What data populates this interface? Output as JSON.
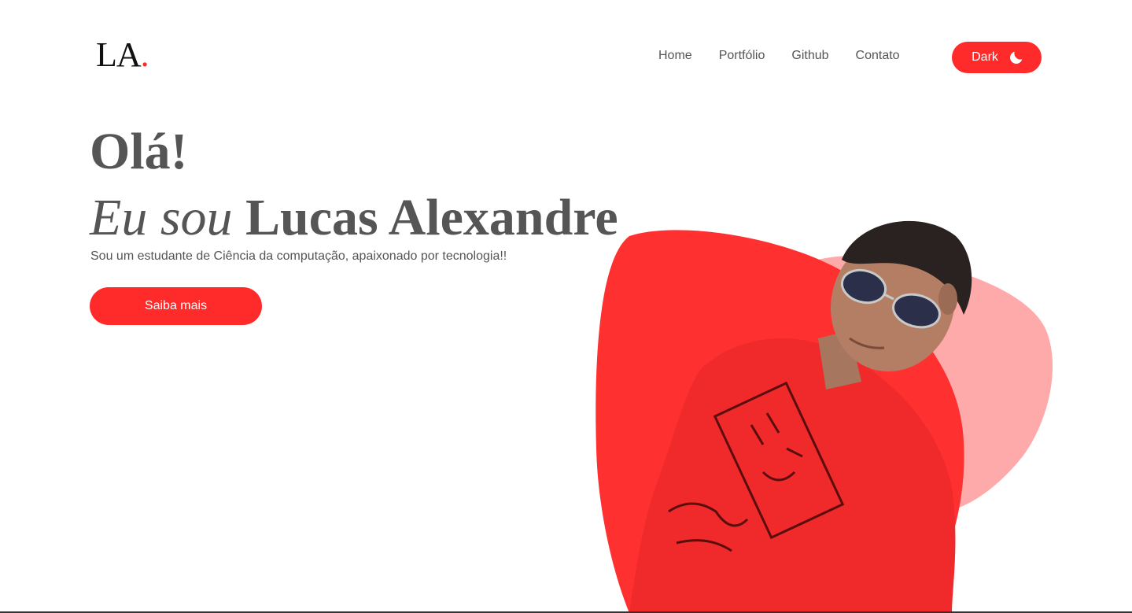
{
  "logo": {
    "text": "LA",
    "dot": "."
  },
  "nav": {
    "items": [
      {
        "label": "Home"
      },
      {
        "label": "Portfólio"
      },
      {
        "label": "Github"
      },
      {
        "label": "Contato"
      }
    ]
  },
  "theme_toggle": {
    "label": "Dark",
    "icon": "moon-icon"
  },
  "hero": {
    "greeting": "Olá!",
    "intro_prefix": "Eu sou",
    "name": "Lucas Alexandre",
    "subtitle": "Sou um estudante de Ciência da computação, apaixonado por tecnologia!!",
    "cta_label": "Saiba mais",
    "photo": "person-photo"
  },
  "colors": {
    "accent": "#ff2a2a",
    "accent_light": "#ffaaaa",
    "text": "#555555"
  }
}
